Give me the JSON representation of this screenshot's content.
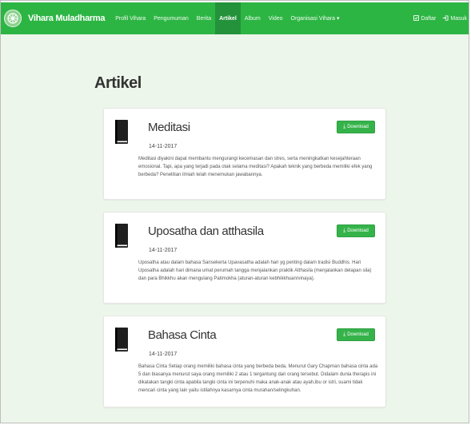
{
  "brand": {
    "name": "Vihara Muladharma"
  },
  "nav": {
    "items": [
      {
        "label": "Profil Vihara",
        "active": false
      },
      {
        "label": "Pengumuman",
        "active": false
      },
      {
        "label": "Berita",
        "active": false
      },
      {
        "label": "Artikel",
        "active": true
      },
      {
        "label": "Album",
        "active": false
      },
      {
        "label": "Video",
        "active": false
      },
      {
        "label": "Organisasi Vihara ▾",
        "active": false
      }
    ],
    "right": [
      {
        "label": "Daftar",
        "icon": "register-icon"
      },
      {
        "label": "Masuk",
        "icon": "login-icon"
      }
    ]
  },
  "page": {
    "title": "Artikel"
  },
  "download_label": "Download",
  "articles": [
    {
      "title": "Meditasi",
      "date": "14-11-2017",
      "excerpt": "Meditasi diyakini dapat membantu mengurangi kecemasan dan stres, serta meningkatkan kesejahteraan emosional. Tapi, apa yang terjadi pada otak selama meditasi? Apakah teknik yang berbeda memiliki efek yang berbeda? Penelitian ilmiah telah menemukan jawabannya."
    },
    {
      "title": "Uposatha dan atthasila",
      "date": "14-11-2017",
      "excerpt": "Uposatha atau dalam bahasa Sansekerta Upavasatha adalah hari yg penting dalam tradisi Buddhis. Hari Uposatha adalah hari dimana umat perumah tangga menjalankan praktik Atthasila (menjalankan delapan sila) dan para Bhikkhu akan mengulang Patimokha (aturan-aturan kebhikkhuan/vinaya)."
    },
    {
      "title": "Bahasa Cinta",
      "date": "14-11-2017",
      "excerpt": "Bahasa Cinta Setiap orang memiliki bahasa cinta yang berbeda beda, Menurut Gary Chapman bahasa cinta ada 5 dan biasanya menurut saya orang memiliki 2 atau 1 tergantung dari orang tersebut. Didalam dunia therapis ini dikatakan tangki cinta apabila tangki cinta ini terpenuhi maka anak-anak atau ayah,ibu or istri, suami tidak mencari cinta yang lain yaitu istilahnya kasarnya cinta murahan/selingkuhan."
    }
  ],
  "colors": {
    "navbar": "#2db544",
    "navbar_active": "#23923a",
    "page_bg": "#edf6ea",
    "button": "#35b34a"
  }
}
